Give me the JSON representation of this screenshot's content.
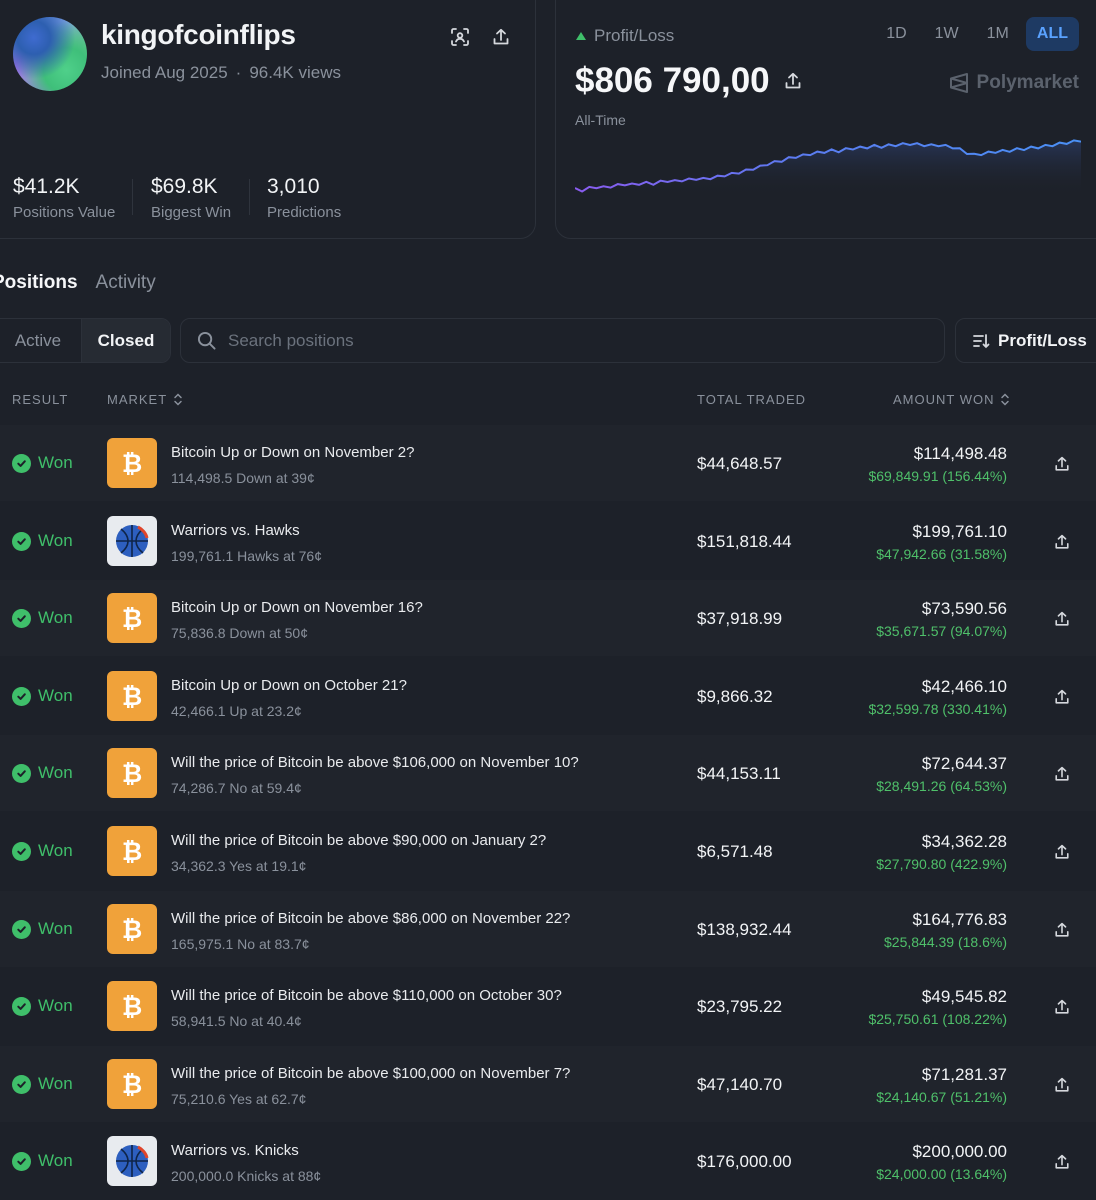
{
  "profile": {
    "username": "kingofcoinflips",
    "joined": "Joined Aug 2025",
    "separator": "·",
    "views": "96.4K views",
    "stats": [
      {
        "value": "$41.2K",
        "label": "Positions Value"
      },
      {
        "value": "$69.8K",
        "label": "Biggest Win"
      },
      {
        "value": "3,010",
        "label": "Predictions"
      }
    ]
  },
  "pnl": {
    "label": "Profit/Loss",
    "value": "$806 790,00",
    "period": "All-Time",
    "brand": "Polymarket",
    "timeframes": [
      "1D",
      "1W",
      "1M",
      "ALL"
    ],
    "active_timeframe": "ALL",
    "line_color": "#5b7cf0",
    "series": [
      0.05,
      0.03,
      0.07,
      0.09,
      0.08,
      0.1,
      0.12,
      0.14,
      0.13,
      0.15,
      0.16,
      0.15,
      0.18,
      0.2,
      0.19,
      0.21,
      0.22,
      0.24,
      0.23,
      0.25,
      0.27,
      0.3,
      0.32,
      0.35,
      0.38,
      0.42,
      0.45,
      0.5,
      0.53,
      0.56,
      0.6,
      0.63,
      0.65,
      0.68,
      0.7,
      0.72,
      0.74,
      0.73,
      0.76,
      0.78,
      0.79,
      0.8,
      0.82,
      0.81,
      0.83,
      0.84,
      0.85,
      0.86,
      0.85,
      0.84,
      0.83,
      0.84,
      0.82,
      0.8,
      0.76,
      0.7,
      0.66,
      0.68,
      0.7,
      0.72,
      0.73,
      0.74,
      0.76,
      0.77,
      0.79,
      0.8,
      0.82,
      0.84,
      0.86,
      0.88,
      0.9,
      0.92
    ]
  },
  "tabs": [
    "Positions",
    "Activity"
  ],
  "filters": {
    "status": [
      "Active",
      "Closed"
    ],
    "active_status": "Closed",
    "search_placeholder": "Search positions",
    "sort_label": "Profit/Loss"
  },
  "table": {
    "headers": {
      "result": "RESULT",
      "market": "MARKET",
      "total_traded": "TOTAL TRADED",
      "amount_won": "AMOUNT WON"
    },
    "rows": [
      {
        "result": "Won",
        "icon": "bitcoin-icon",
        "title": "Bitcoin Up or Down on November 2?",
        "sub": "114,498.5 Down at 39¢",
        "traded": "$44,648.57",
        "won": "$114,498.48",
        "profit": "$69,849.91 (156.44%)"
      },
      {
        "result": "Won",
        "icon": "basketball-icon",
        "title": "Warriors vs. Hawks",
        "sub": "199,761.1 Hawks at 76¢",
        "traded": "$151,818.44",
        "won": "$199,761.10",
        "profit": "$47,942.66 (31.58%)"
      },
      {
        "result": "Won",
        "icon": "bitcoin-icon",
        "title": "Bitcoin Up or Down on November 16?",
        "sub": "75,836.8 Down at 50¢",
        "traded": "$37,918.99",
        "won": "$73,590.56",
        "profit": "$35,671.57 (94.07%)"
      },
      {
        "result": "Won",
        "icon": "bitcoin-icon",
        "title": "Bitcoin Up or Down on October 21?",
        "sub": "42,466.1 Up at 23.2¢",
        "traded": "$9,866.32",
        "won": "$42,466.10",
        "profit": "$32,599.78 (330.41%)"
      },
      {
        "result": "Won",
        "icon": "bitcoin-icon",
        "title": "Will the price of Bitcoin be above $106,000 on November 10?",
        "sub": "74,286.7 No at 59.4¢",
        "traded": "$44,153.11",
        "won": "$72,644.37",
        "profit": "$28,491.26 (64.53%)"
      },
      {
        "result": "Won",
        "icon": "bitcoin-icon",
        "title": "Will the price of Bitcoin be above $90,000 on January 2?",
        "sub": "34,362.3 Yes at 19.1¢",
        "traded": "$6,571.48",
        "won": "$34,362.28",
        "profit": "$27,790.80 (422.9%)"
      },
      {
        "result": "Won",
        "icon": "bitcoin-icon",
        "title": "Will the price of Bitcoin be above $86,000 on November 22?",
        "sub": "165,975.1 No at 83.7¢",
        "traded": "$138,932.44",
        "won": "$164,776.83",
        "profit": "$25,844.39 (18.6%)"
      },
      {
        "result": "Won",
        "icon": "bitcoin-icon",
        "title": "Will the price of Bitcoin be above $110,000 on October 30?",
        "sub": "58,941.5 No at 40.4¢",
        "traded": "$23,795.22",
        "won": "$49,545.82",
        "profit": "$25,750.61 (108.22%)"
      },
      {
        "result": "Won",
        "icon": "bitcoin-icon",
        "title": "Will the price of Bitcoin be above $100,000 on November 7?",
        "sub": "75,210.6 Yes at 62.7¢",
        "traded": "$47,140.70",
        "won": "$71,281.37",
        "profit": "$24,140.67 (51.21%)"
      },
      {
        "result": "Won",
        "icon": "basketball-icon",
        "title": "Warriors vs. Knicks",
        "sub": "200,000.0 Knicks at 88¢",
        "traded": "$176,000.00",
        "won": "$200,000.00",
        "profit": "$24,000.00 (13.64%)"
      }
    ]
  },
  "colors": {
    "accent": "#5aa2ff",
    "positive": "#3fbf6a",
    "bitcoin": "#f0a23a"
  }
}
